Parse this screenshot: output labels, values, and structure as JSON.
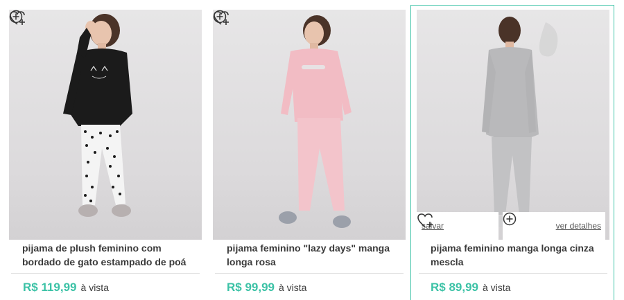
{
  "products": [
    {
      "title": "pijama de plush feminino com bordado de gato estampado de poá",
      "price": "R$ 119,99",
      "price_suffix": "à vista",
      "image": "woman-black-sweater-polka-dot-pants"
    },
    {
      "title": "pijama feminino \"lazy days\" manga longa rosa",
      "price": "R$ 99,99",
      "price_suffix": "à vista",
      "image": "woman-pink-pajama"
    },
    {
      "title": "pijama feminino manga longa cinza mescla",
      "price": "R$ 89,99",
      "price_suffix": "à vista",
      "image": "woman-grey-pajama-back-view",
      "save_label": "salvar",
      "details_label": "ver detalhes"
    }
  ],
  "colors": {
    "accent": "#3cc2a6",
    "text": "#3a3a3a"
  },
  "icons": {
    "favorite": "heart-plus-icon",
    "add": "plus-circle-icon"
  }
}
